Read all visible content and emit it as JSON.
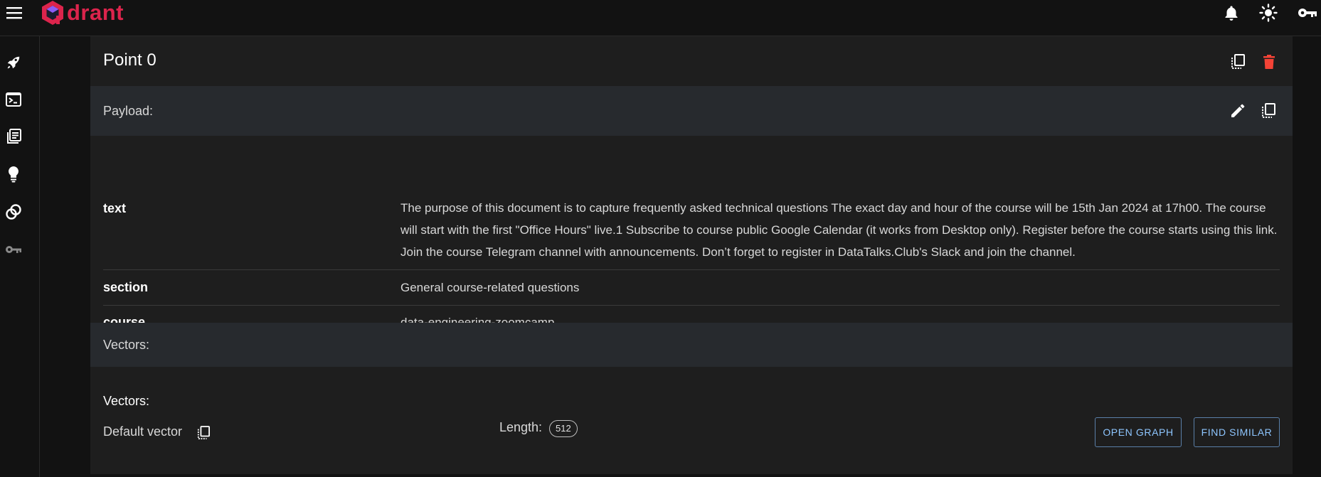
{
  "topbar": {
    "menu_icon": "menu-icon",
    "logo_text": "drant",
    "actions": [
      "bell-icon",
      "sun-icon",
      "key-icon"
    ]
  },
  "sidebar": {
    "items": [
      "rocket-icon",
      "terminal-icon",
      "collections-icon",
      "lightbulb-icon",
      "tutorial-icon",
      "key-icon"
    ]
  },
  "point": {
    "title": "Point 0",
    "payload_label": "Payload:",
    "payload": [
      {
        "key": "text",
        "value": "The purpose of this document is to capture frequently asked technical questions The exact day and hour of the course will be 15th Jan 2024 at 17h00. The course will start with the first \"Office Hours\" live.1 Subscribe to course public Google Calendar (it works from Desktop only). Register before the course starts using this link. Join the course Telegram channel with announcements. Don’t forget to register in DataTalks.Club's Slack and join the channel."
      },
      {
        "key": "section",
        "value": "General course-related questions"
      },
      {
        "key": "course",
        "value": "data-engineering-zoomcamp"
      }
    ],
    "vectors_bar_label": "Vectors:",
    "vectors_label": "Vectors:",
    "default_vector_label": "Default vector",
    "length_label": "Length:",
    "length_value": "512",
    "open_graph_label": "OPEN GRAPH",
    "find_similar_label": "FIND SIMILAR"
  },
  "colors": {
    "accent": "#dc244c",
    "delete": "#f44336",
    "button_text": "#8ec6ff",
    "background": "#121212",
    "card": "#1e1e1e",
    "section_bar": "#272a2e"
  }
}
